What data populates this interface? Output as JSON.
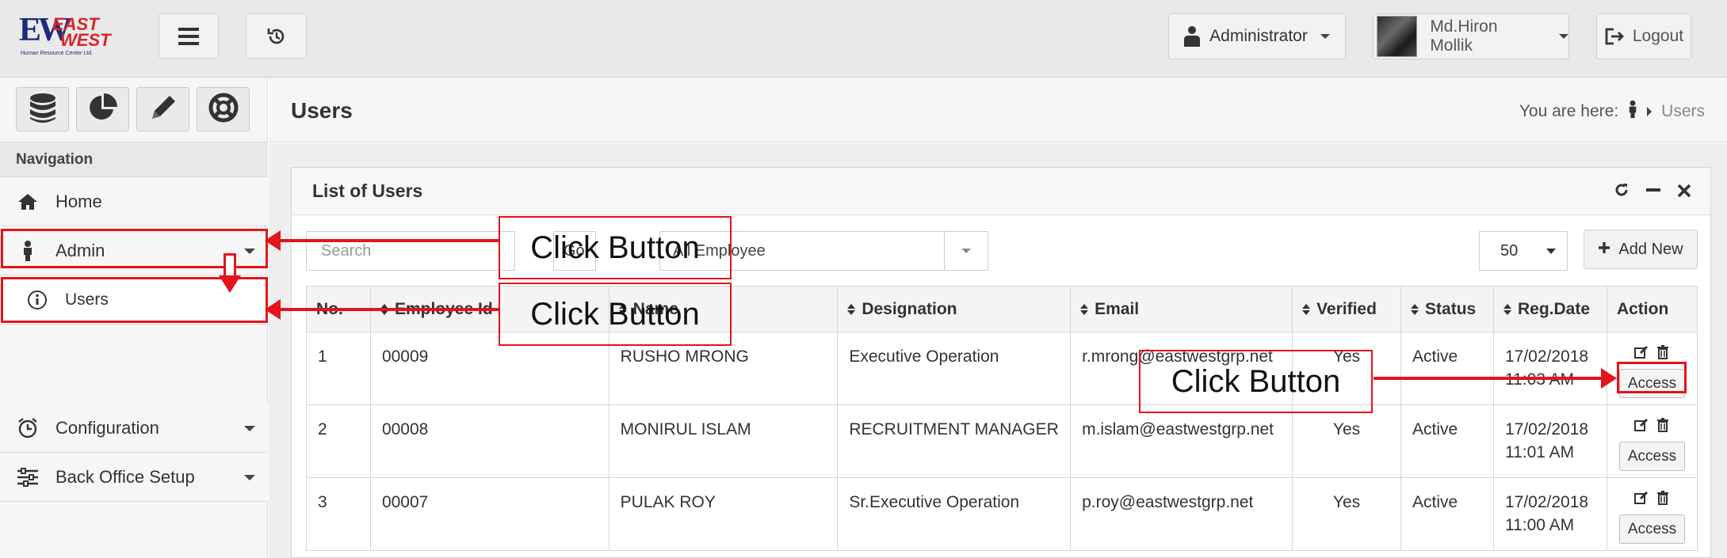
{
  "brand": {
    "ew": "EW",
    "east": "EAST",
    "west": "WEST",
    "sub": "Human Resource Center Ltd."
  },
  "topbar": {
    "role": "Administrator",
    "user": "Md.Hiron Mollik",
    "logout": "Logout"
  },
  "sidebar": {
    "title": "Navigation",
    "items": [
      {
        "label": "Home",
        "icon": "home-icon"
      },
      {
        "label": "Admin",
        "icon": "user-icon"
      },
      {
        "label": "Users",
        "icon": "info-icon"
      },
      {
        "label": "Configuration",
        "icon": "alarm-icon"
      },
      {
        "label": "Back Office Setup",
        "icon": "sliders-icon"
      }
    ]
  },
  "header": {
    "title": "Users",
    "breadcrumb_prefix": "You are here:",
    "breadcrumb_current": "Users"
  },
  "panel": {
    "title": "List of Users",
    "search_placeholder": "Search",
    "go_label": "Go",
    "employee_filter": "All Employee",
    "per_page": "50",
    "add_new": "Add New"
  },
  "table": {
    "headers": [
      "No.",
      "Employee Id",
      "Name",
      "Designation",
      "Email",
      "Verified",
      "Status",
      "Reg.Date",
      "Action"
    ],
    "rows": [
      {
        "no": "1",
        "emp_id": "00009",
        "name": "RUSHO MRONG",
        "designation": "Executive Operation",
        "email": "r.mrong@eastwestgrp.net",
        "verified": "Yes",
        "status": "Active",
        "date": "17/02/2018",
        "time": "11:03 AM",
        "action": "Access"
      },
      {
        "no": "2",
        "emp_id": "00008",
        "name": "MONIRUL ISLAM",
        "designation": "RECRUITMENT MANAGER",
        "email": "m.islam@eastwestgrp.net",
        "verified": "Yes",
        "status": "Active",
        "date": "17/02/2018",
        "time": "11:01 AM",
        "action": "Access"
      },
      {
        "no": "3",
        "emp_id": "00007",
        "name": "PULAK ROY",
        "designation": "Sr.Executive Operation",
        "email": "p.roy@eastwestgrp.net",
        "verified": "Yes",
        "status": "Active",
        "date": "17/02/2018",
        "time": "11:00 AM",
        "action": "Access"
      }
    ]
  },
  "annotations": {
    "label_1": "Click Button",
    "label_2": "Click Button",
    "label_3": "Click Button"
  },
  "colors": {
    "annotation": "#e3141b",
    "brand_blue": "#1d2a7a",
    "brand_red": "#d6262b"
  }
}
